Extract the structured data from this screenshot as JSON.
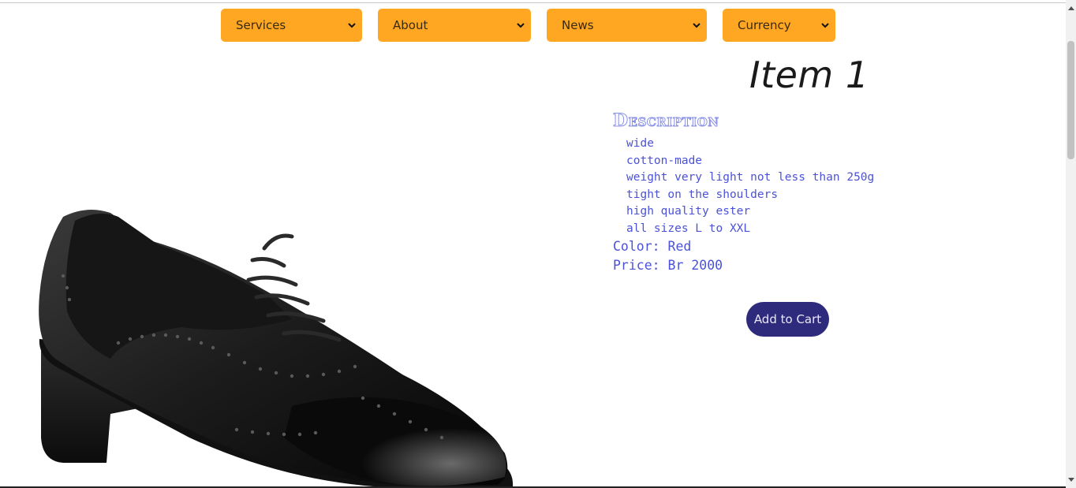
{
  "nav": {
    "services": "Services",
    "about": "About",
    "news": "News",
    "currency": "Currency"
  },
  "colors": {
    "nav_bg": "#ffa722",
    "accent_text": "#4b52d8",
    "cart_button": "#2e2b7c"
  },
  "product": {
    "title": "Item 1",
    "image_icon": "shoe-image",
    "description_heading": "Description",
    "description_items": [
      "wide",
      "cotton-made",
      "weight very light not less than 250g",
      "tight on the shoulders",
      "high quality ester",
      "all sizes L to XXL"
    ],
    "color_line": "Color: Red",
    "price_line": "Price: Br 2000",
    "add_to_cart_label": "Add to Cart"
  }
}
